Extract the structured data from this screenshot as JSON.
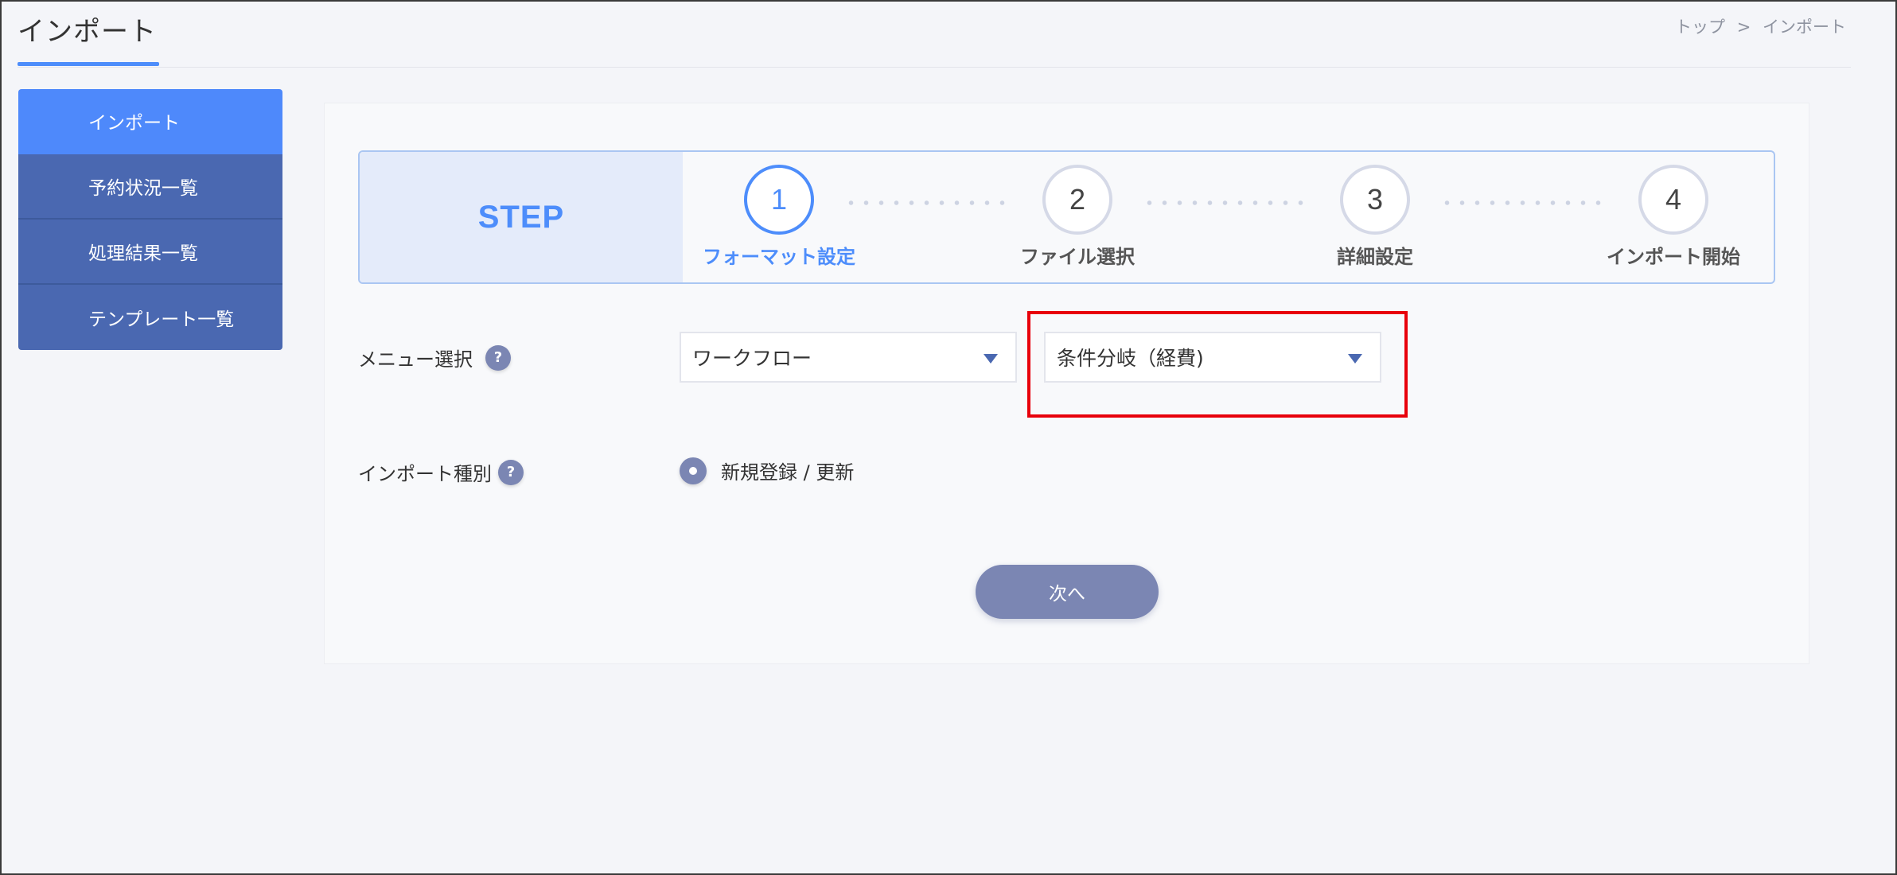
{
  "header": {
    "title": "インポート",
    "breadcrumb": [
      "トップ",
      ">",
      "インポート"
    ]
  },
  "sidebar": {
    "items": [
      {
        "label": "インポート",
        "active": true
      },
      {
        "label": "予約状況一覧"
      },
      {
        "label": "処理結果一覧"
      },
      {
        "label": "テンプレート一覧"
      }
    ]
  },
  "steps": {
    "label": "STEP",
    "items": [
      {
        "number": "1",
        "name": "フォーマット設定",
        "active": true
      },
      {
        "number": "2",
        "name": "ファイル選択"
      },
      {
        "number": "3",
        "name": "詳細設定"
      },
      {
        "number": "4",
        "name": "インポート開始"
      }
    ]
  },
  "form": {
    "menu_label": "メニュー選択",
    "menu_select_1": "ワークフロー",
    "menu_select_2": "条件分岐（経費)",
    "import_type_label": "インポート種別",
    "import_type_option": "新規登録 / 更新",
    "help_glyph": "?"
  },
  "actions": {
    "next_label": "次へ"
  },
  "colors": {
    "accent": "#4d8dfb",
    "sidebar": "#4a68b1",
    "button": "#7b86b3",
    "highlight": "#e8000b"
  }
}
